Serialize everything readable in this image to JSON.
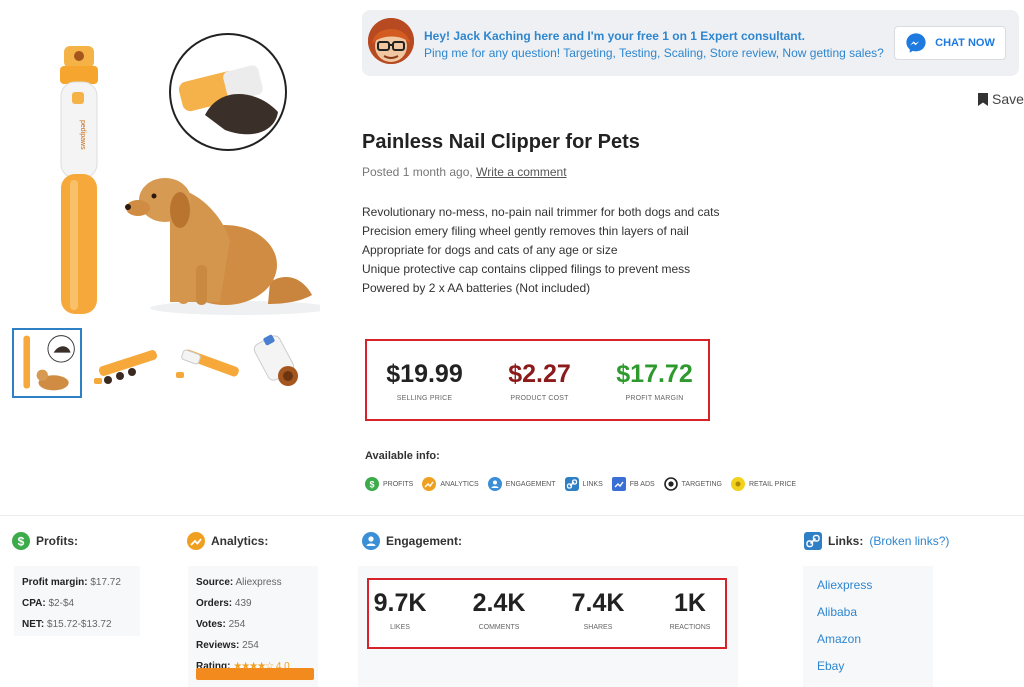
{
  "chat": {
    "line1": "Hey! Jack Kaching here and I'm your free 1 on 1 Expert consultant.",
    "line2": "Ping me for any question! Targeting, Testing, Scaling, Store review, Now getting sales?",
    "button_label": "CHAT NOW",
    "accent_color": "#2e86cf"
  },
  "save_label": "Save",
  "product": {
    "title": "Painless Nail Clipper for Pets",
    "posted": "Posted 1 month ago,",
    "comment_link": "Write a comment",
    "features": [
      "Revolutionary no-mess, no-pain nail trimmer for both dogs and cats",
      "Precision emery filing wheel gently removes thin layers of nail",
      "Appropriate for dogs and cats of any age or size",
      "Unique protective cap contains clipped filings to prevent mess",
      "Powered by 2 x AA batteries (Not included)"
    ],
    "device_brand_text": "pedipaws"
  },
  "prices": [
    {
      "value": "$19.99",
      "label": "SELLING PRICE",
      "color": "#222222"
    },
    {
      "value": "$2.27",
      "label": "PRODUCT COST",
      "color": "#8b1a1a"
    },
    {
      "value": "$17.72",
      "label": "PROFIT MARGIN",
      "color": "#2e9a2e"
    }
  ],
  "available": {
    "title": "Available info:",
    "items": [
      {
        "label": "PROFITS",
        "icon": "dollar-icon",
        "color": "#3cab4a"
      },
      {
        "label": "ANALYTICS",
        "icon": "analytics-icon",
        "color": "#f0a020"
      },
      {
        "label": "ENGAGEMENT",
        "icon": "engagement-icon",
        "color": "#3a8fd6"
      },
      {
        "label": "LINKS",
        "icon": "link-icon",
        "color": "#2f7fc4"
      },
      {
        "label": "FB ADS",
        "icon": "fb-ads-icon",
        "color": "#3a6fd6"
      },
      {
        "label": "TARGETING",
        "icon": "target-icon",
        "color": "#222222"
      },
      {
        "label": "RETAIL PRICE",
        "icon": "retail-price-icon",
        "color": "#f2d11d"
      }
    ]
  },
  "sections": {
    "profits": {
      "title": "Profits:",
      "rows": [
        {
          "k": "Profit margin:",
          "v": "$17.72"
        },
        {
          "k": "CPA:",
          "v": "$2-$4"
        },
        {
          "k": "NET:",
          "v": "$15.72-$13.72"
        }
      ]
    },
    "analytics": {
      "title": "Analytics:",
      "rows": [
        {
          "k": "Source:",
          "v": "Aliexpress"
        },
        {
          "k": "Orders:",
          "v": "439"
        },
        {
          "k": "Votes:",
          "v": "254"
        },
        {
          "k": "Reviews:",
          "v": "254"
        }
      ],
      "rating_label": "Rating:",
      "rating_stars": "★★★★☆",
      "rating_value": "4.0"
    },
    "engagement": {
      "title": "Engagement:",
      "stats": [
        {
          "value": "9.7K",
          "label": "LIKES"
        },
        {
          "value": "2.4K",
          "label": "COMMENTS"
        },
        {
          "value": "7.4K",
          "label": "SHARES"
        },
        {
          "value": "1K",
          "label": "REACTIONS"
        }
      ]
    },
    "links": {
      "title": "Links:",
      "broken_open": "(",
      "broken": "Broken links?",
      "broken_close": ")",
      "items": [
        "Aliexpress",
        "Alibaba",
        "Amazon",
        "Ebay"
      ]
    }
  }
}
